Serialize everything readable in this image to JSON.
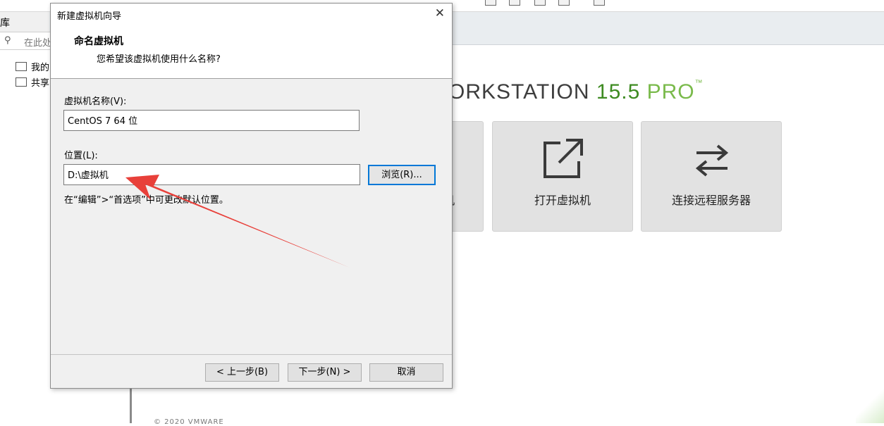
{
  "background": {
    "library_title": "库",
    "search_placeholder": "在此处",
    "tree_items": [
      "我的",
      "共享"
    ],
    "brand": {
      "part_dark": "ORKSTATION ",
      "version": "15.5",
      "edition": " PRO",
      "tm": "™"
    },
    "tiles": [
      {
        "label": "机",
        "icon": "create-vm-icon"
      },
      {
        "label": "打开虚拟机",
        "icon": "open-external-icon"
      },
      {
        "label": "连接远程服务器",
        "icon": "swap-arrows-icon"
      }
    ],
    "copyright": "© 2020 VMWARE"
  },
  "dialog": {
    "title": "新建虚拟机向导",
    "header_title": "命名虚拟机",
    "header_subtitle": "您希望该虚拟机使用什么名称?",
    "name_label": "虚拟机名称(V):",
    "name_value": "CentOS 7 64 位",
    "location_label": "位置(L):",
    "location_value": "D:\\虚拟机",
    "browse_label": "浏览(R)...",
    "hint": "在“编辑”>“首选项”中可更改默认位置。",
    "back_label": "< 上一步(B)",
    "next_label": "下一步(N) >",
    "cancel_label": "取消"
  },
  "colors": {
    "brand_green": "#3e8b22",
    "brand_light_green": "#7aba4b",
    "annotation_red": "#e8403a",
    "focus_blue": "#0078d7"
  }
}
